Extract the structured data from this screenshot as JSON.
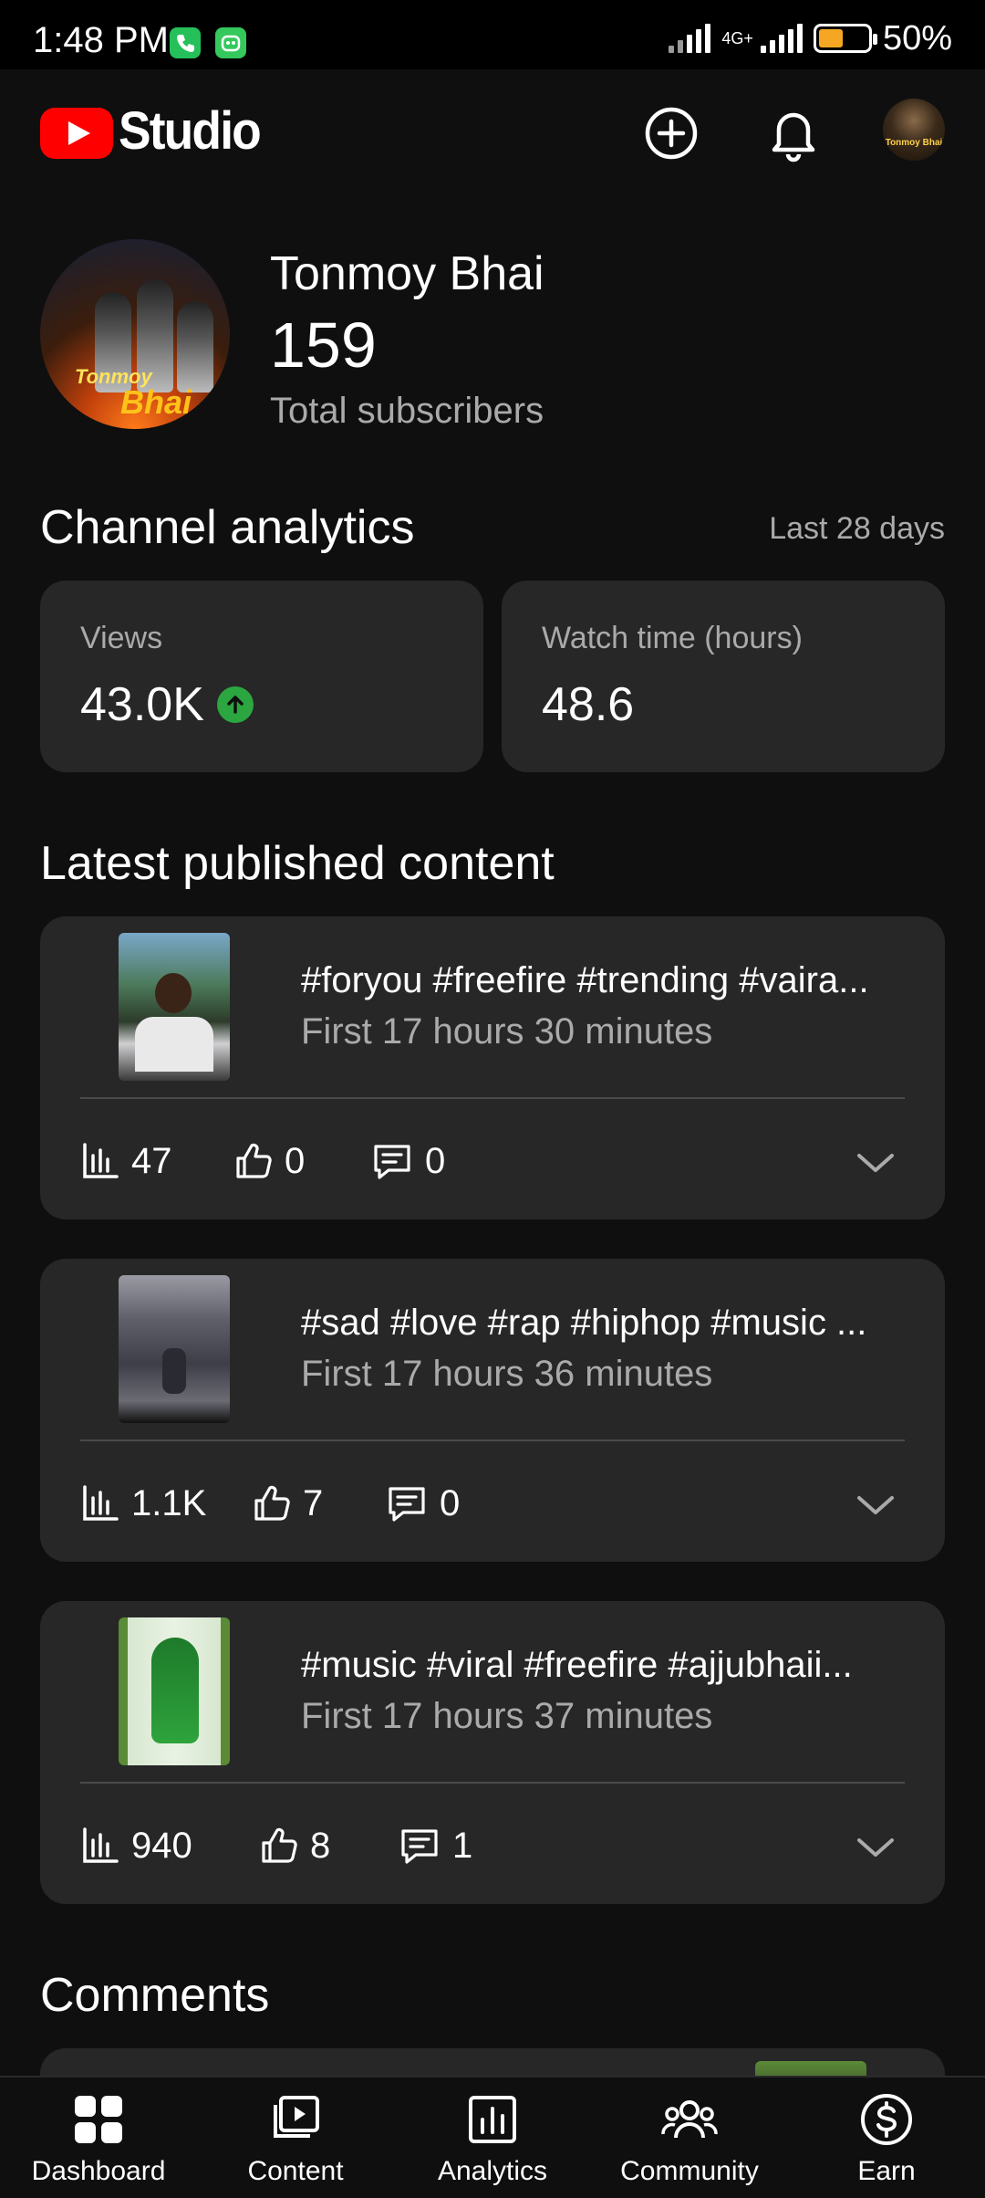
{
  "status_bar": {
    "time": "1:48 PM",
    "network": "4G+",
    "battery": "50%",
    "battery_level": 0.5
  },
  "header": {
    "app_name": "Studio",
    "brand_color": "#ff0000",
    "avatar_text": "Tonmoy Bhai"
  },
  "channel": {
    "avatar_name_line1": "Tonmoy",
    "avatar_name_line2": "Bhai",
    "name": "Tonmoy Bhai",
    "subscribers": "159",
    "subscribers_label": "Total subscribers"
  },
  "analytics": {
    "title": "Channel analytics",
    "range": "Last 28 days",
    "views_label": "Views",
    "views_value": "43.0K",
    "views_trend": "up",
    "trend_color": "#2ba640",
    "watch_label": "Watch time (hours)",
    "watch_value": "48.6"
  },
  "latest": {
    "title": "Latest published content",
    "items": [
      {
        "title": "#foryou #freefire #trending #vaira...",
        "subtitle": "First 17 hours 30 minutes",
        "views": "47",
        "likes": "0",
        "comments": "0"
      },
      {
        "title": "#sad #love #rap #hiphop #music ...",
        "subtitle": "First 17 hours 36 minutes",
        "views": "1.1K",
        "likes": "7",
        "comments": "0"
      },
      {
        "title": "#music #viral #freefire #ajjubhaii...",
        "subtitle": "First 17 hours 37 minutes",
        "views": "940",
        "likes": "8",
        "comments": "1"
      }
    ]
  },
  "comments": {
    "title": "Comments"
  },
  "nav": {
    "items": [
      {
        "label": "Dashboard",
        "icon": "dashboard-icon"
      },
      {
        "label": "Content",
        "icon": "content-icon"
      },
      {
        "label": "Analytics",
        "icon": "analytics-icon"
      },
      {
        "label": "Community",
        "icon": "community-icon"
      },
      {
        "label": "Earn",
        "icon": "earn-icon"
      }
    ]
  }
}
